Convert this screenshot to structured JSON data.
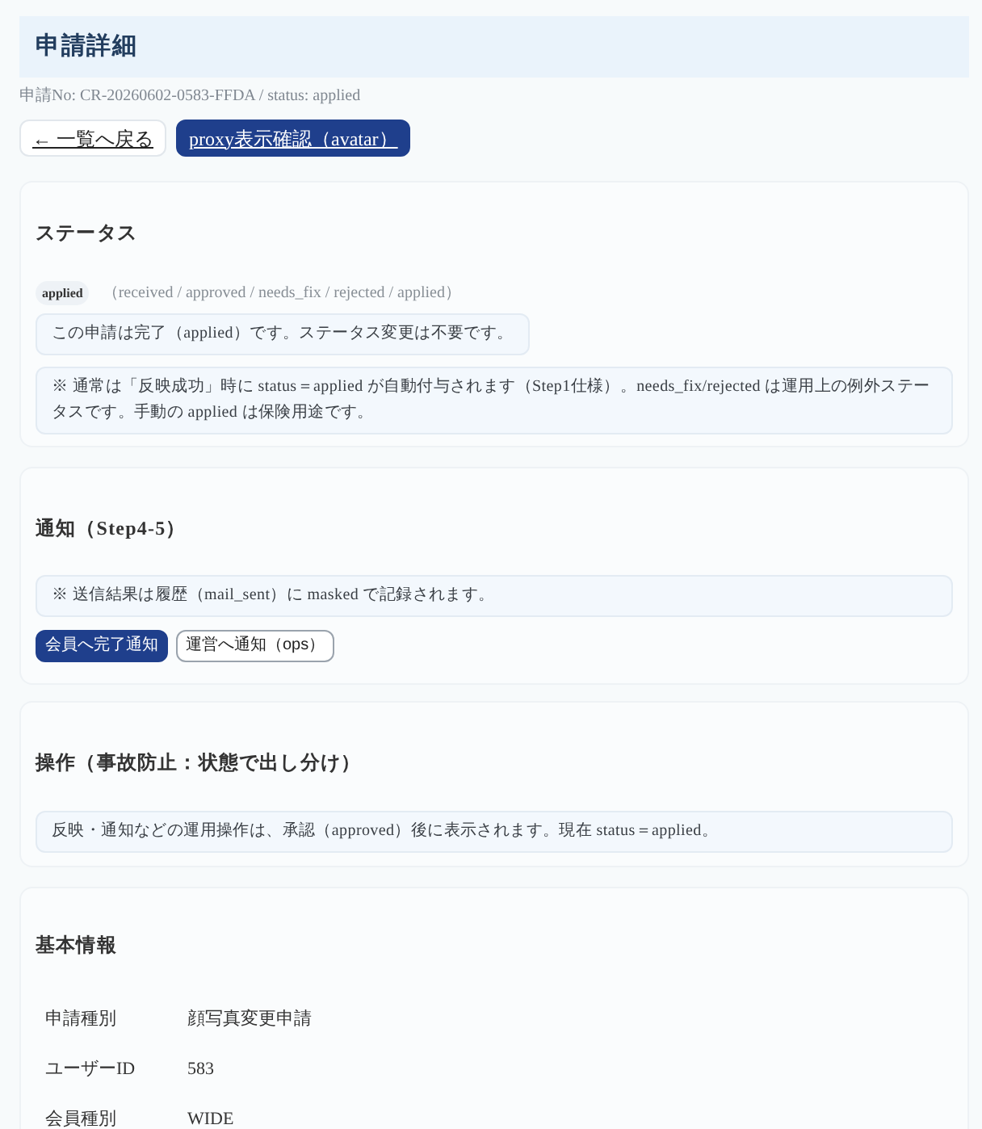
{
  "page": {
    "title": "申請詳細",
    "meta": "申請No: CR-20260602-0583-FFDA / status: applied"
  },
  "top_actions": [
    {
      "label": "← 一覧へ戻る",
      "kind": "link"
    },
    {
      "label": "proxy表示確認（avatar）",
      "kind": "primary"
    }
  ],
  "status_section": {
    "heading": "ステータス",
    "badge": "applied",
    "options": "（received / approved / needs_fix / rejected / applied）",
    "notes": [
      "この申請は完了（applied）です。ステータス変更は不要です。",
      "※ 通常は「反映成功」時に status＝applied が自動付与されます（Step1仕様）。needs_fix/rejected は運用上の例外ステータスです。手動の applied は保険用途です。"
    ]
  },
  "notify_section": {
    "heading": "通知（Step4-5）",
    "note": "※ 送信結果は履歴（mail_sent）に masked で記録されます。",
    "buttons": [
      {
        "label": "会員へ完了通知",
        "kind": "primary"
      },
      {
        "label": "運営へ通知（ops）",
        "kind": "outline"
      }
    ]
  },
  "operations_section": {
    "heading": "操作（事故防止：状態で出し分け）",
    "note": "反映・通知などの運用操作は、承認（approved）後に表示されます。現在 status＝applied。"
  },
  "basic_info": {
    "heading": "基本情報",
    "rows": [
      {
        "label": "申請種別",
        "value": "顔写真変更申請"
      },
      {
        "label": "ユーザーID",
        "value": "583"
      },
      {
        "label": "会員種別",
        "value": "WIDE"
      }
    ]
  }
}
